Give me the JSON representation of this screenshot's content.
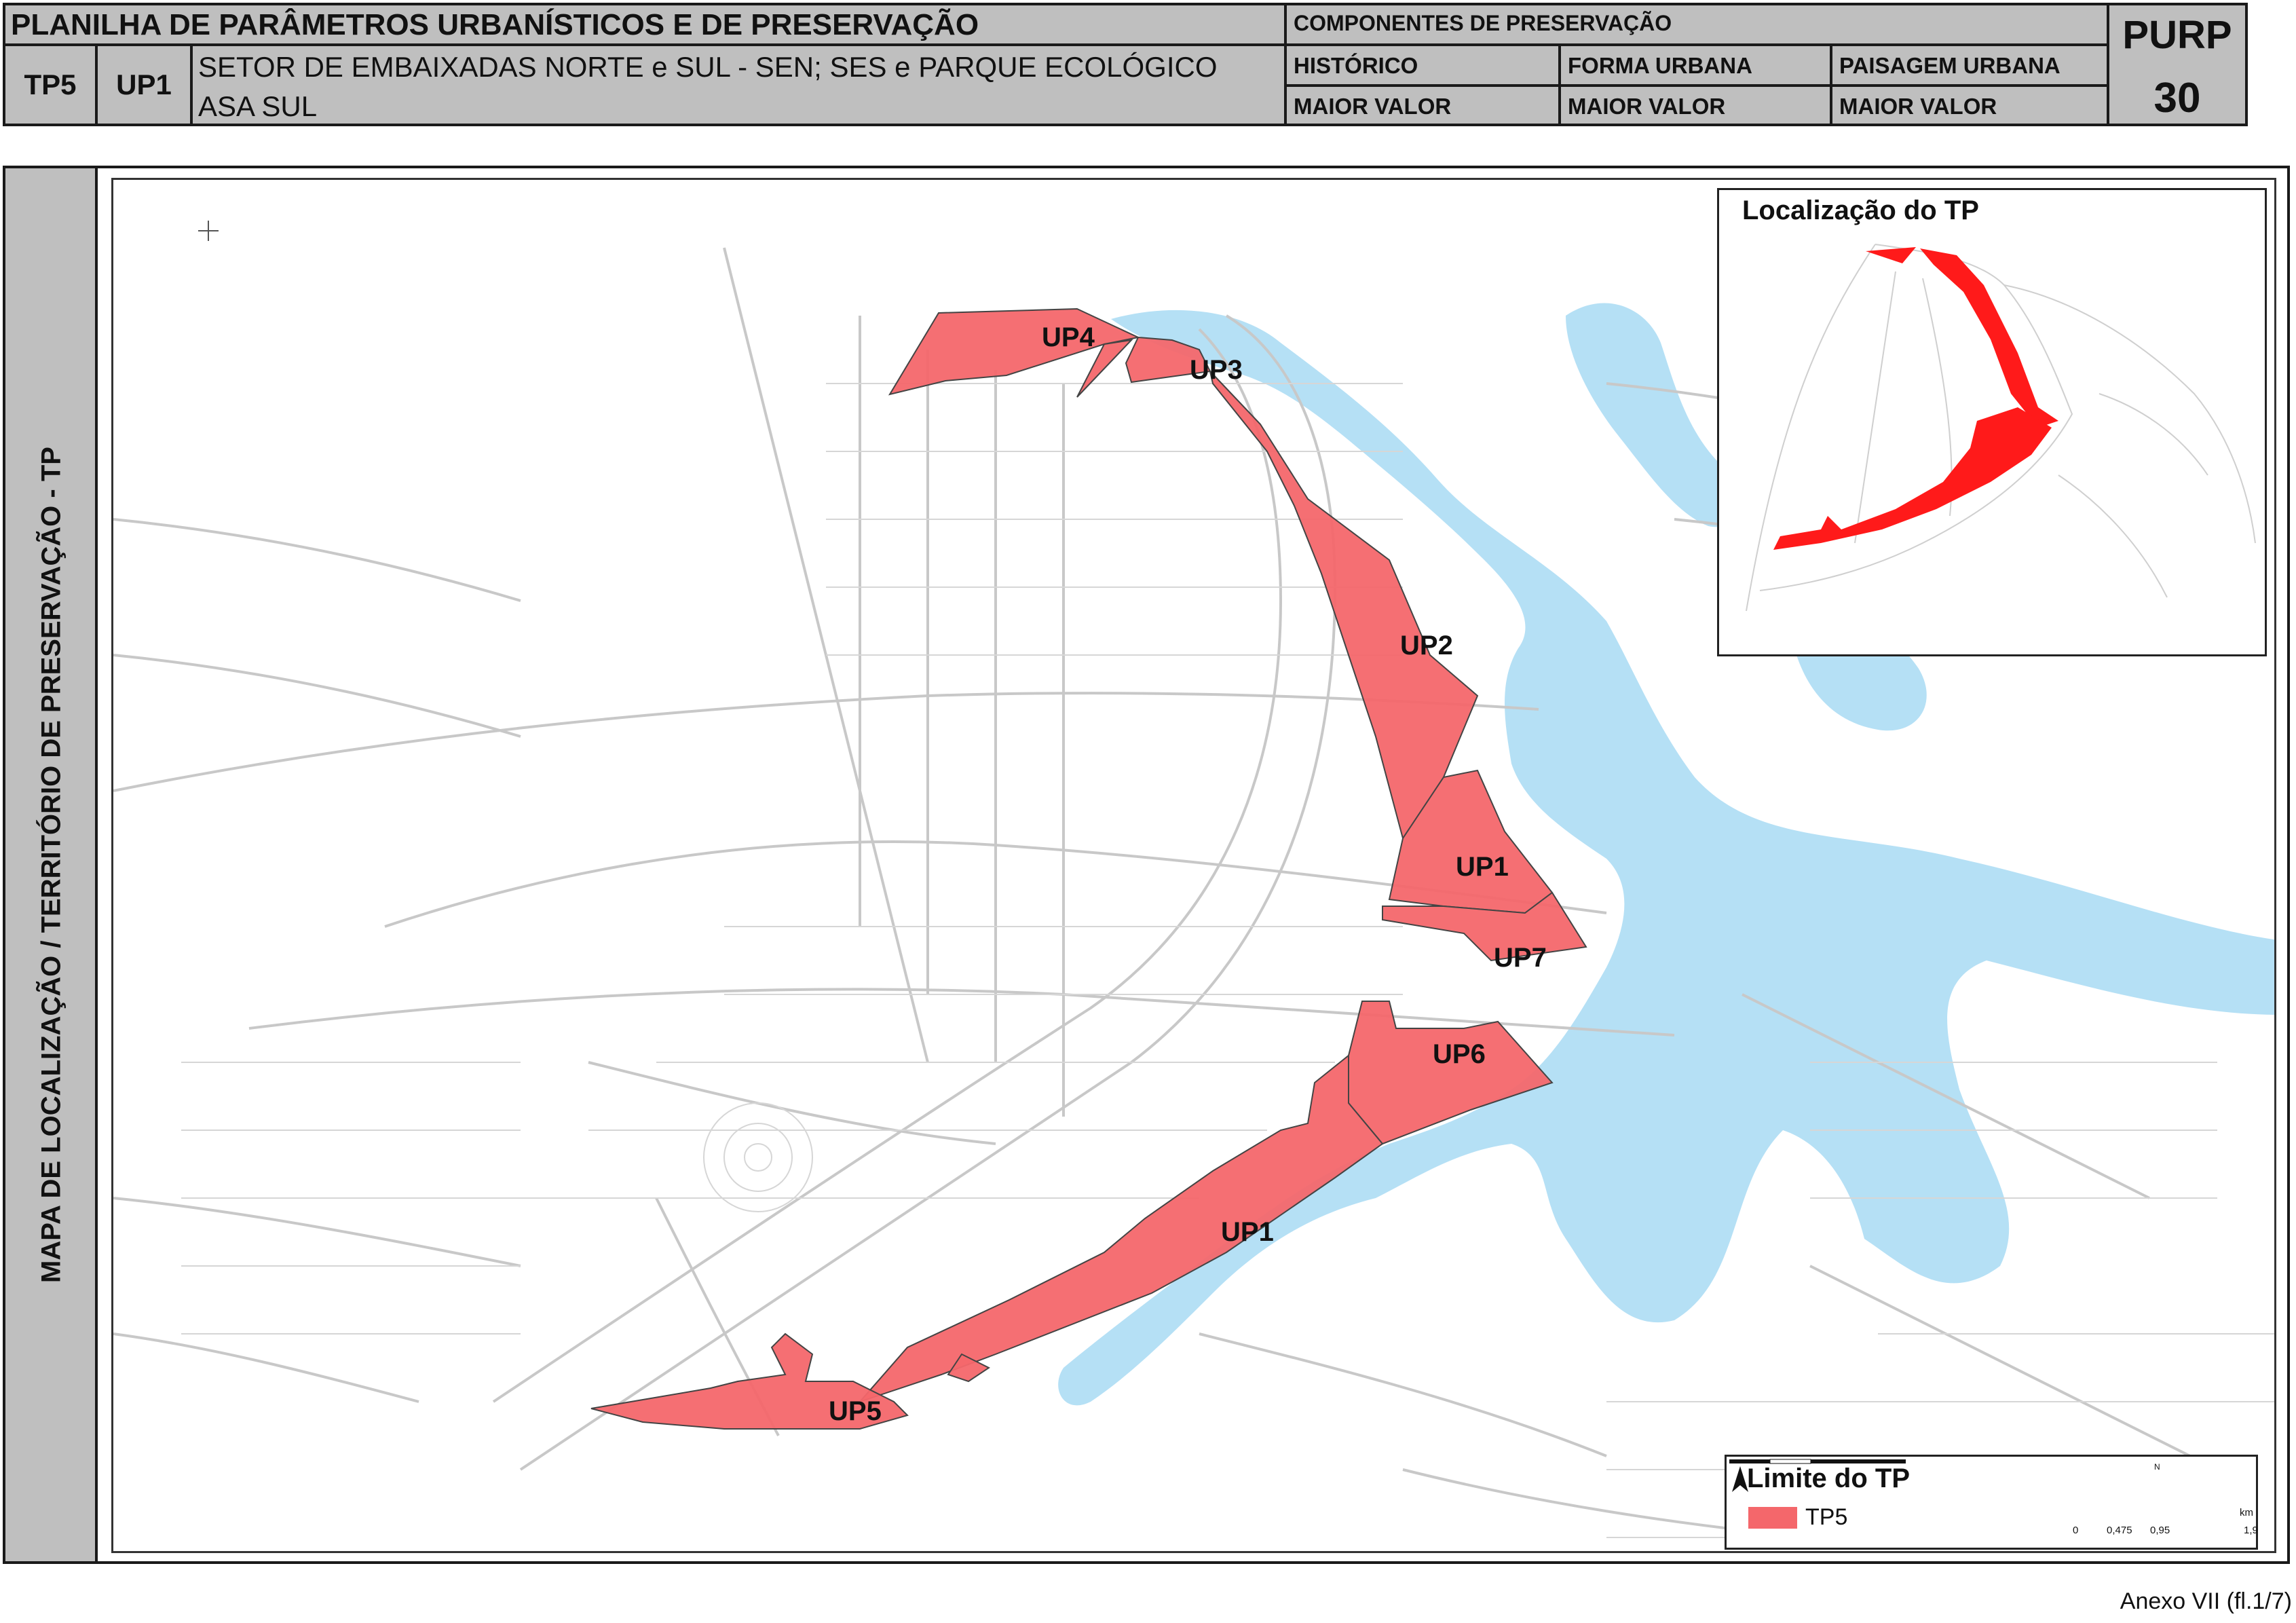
{
  "header": {
    "title": "PLANILHA DE PARÂMETROS URBANÍSTICOS E DE PRESERVAÇÃO",
    "tp": "TP5",
    "up": "UP1",
    "description": "SETOR DE EMBAIXADAS NORTE e SUL - SEN; SES e PARQUE ECOLÓGICO ASA SUL",
    "components_title": "COMPONENTES DE PRESERVAÇÃO",
    "components": [
      {
        "label": "HISTÓRICO",
        "value": "MAIOR VALOR"
      },
      {
        "label": "FORMA URBANA",
        "value": "MAIOR VALOR"
      },
      {
        "label": "PAISAGEM URBANA",
        "value": "MAIOR VALOR"
      }
    ],
    "purp_label": "PURP",
    "purp_number": "30"
  },
  "side_title": "MAPA DE LOCALIZAÇÃO / TERRITÓRIO DE PRESERVAÇÃO - TP",
  "map": {
    "unit_labels": [
      "UP4",
      "UP3",
      "UP2",
      "UP1",
      "UP7",
      "UP6",
      "UP1",
      "UP5"
    ],
    "colors": {
      "water": "#b5e0f5",
      "polygon": "#f4676b",
      "roads": "#c8c8c8"
    }
  },
  "inset": {
    "title": "Localização do TP"
  },
  "legend": {
    "title": "Limite do TP",
    "item": "TP5",
    "north_label": "N",
    "scale_unit": "km",
    "scale_ticks": [
      "0",
      "0,475",
      "0,95",
      "1,9"
    ]
  },
  "footer": "Anexo VII (fl.1/7)"
}
